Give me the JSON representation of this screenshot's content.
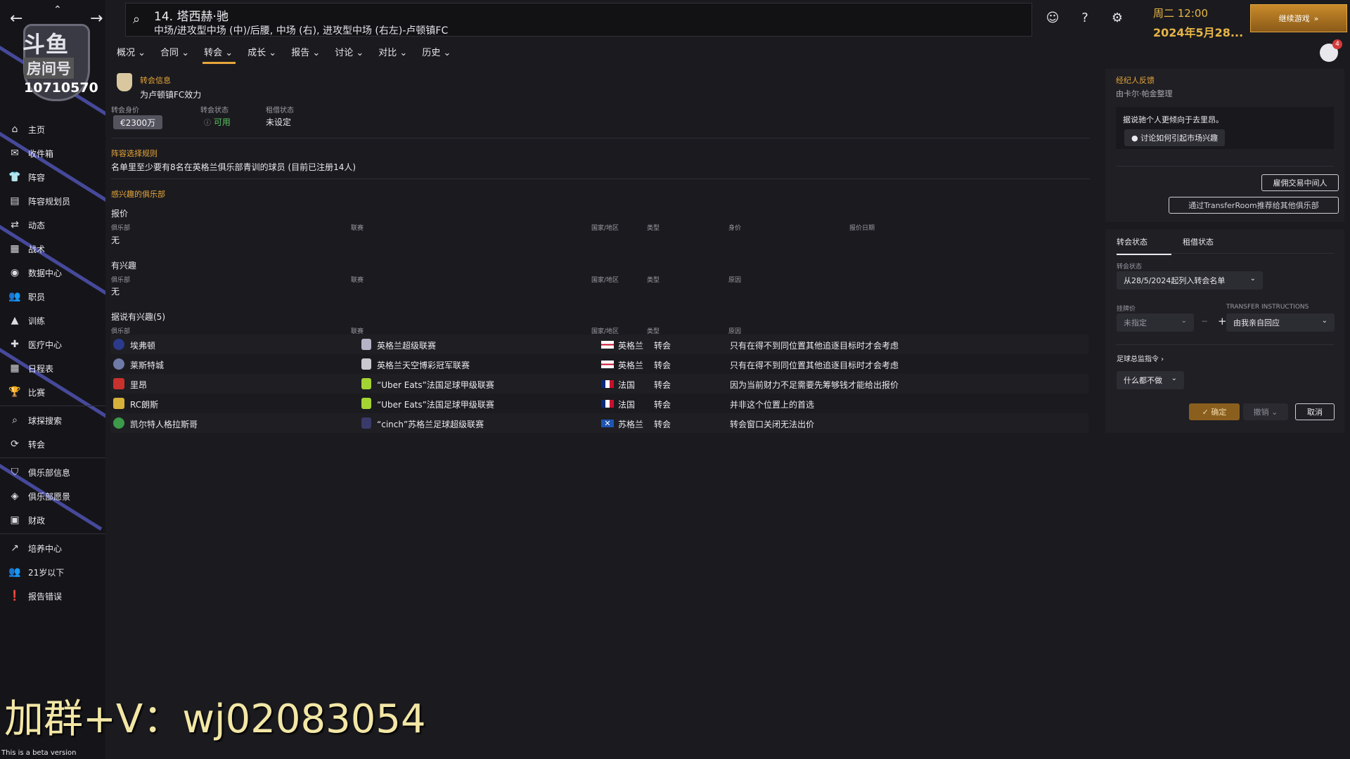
{
  "sidebar": {
    "logo_brand": "斗鱼",
    "logo_sub": "房间号",
    "logo_num": "10710570",
    "items": [
      {
        "label": "主页",
        "icon": "home-icon"
      },
      {
        "label": "收件箱",
        "icon": "inbox-icon"
      },
      {
        "label": "阵容",
        "icon": "shirt-icon"
      },
      {
        "label": "阵容规划员",
        "icon": "clipboard-icon"
      },
      {
        "label": "动态",
        "icon": "dynamics-icon"
      },
      {
        "label": "战术",
        "icon": "tactics-icon"
      },
      {
        "label": "数据中心",
        "icon": "data-hub-icon"
      },
      {
        "label": "职员",
        "icon": "staff-icon"
      },
      {
        "label": "训练",
        "icon": "training-icon"
      },
      {
        "label": "医疗中心",
        "icon": "medical-icon"
      },
      {
        "label": "日程表",
        "icon": "calendar-icon"
      },
      {
        "label": "比赛",
        "icon": "trophy-icon"
      },
      {
        "label": "球探搜索",
        "icon": "scouting-icon"
      },
      {
        "label": "转会",
        "icon": "transfer-icon"
      },
      {
        "label": "俱乐部信息",
        "icon": "shield-icon"
      },
      {
        "label": "俱乐部愿景",
        "icon": "vision-icon"
      },
      {
        "label": "财政",
        "icon": "finance-icon"
      },
      {
        "label": "培养中心",
        "icon": "development-icon"
      },
      {
        "label": "21岁以下",
        "icon": "u21-icon"
      },
      {
        "label": "报告错误",
        "icon": "error-report-icon"
      }
    ]
  },
  "topbar": {
    "player_title": "14. 塔西赫·驰",
    "player_subtitle": "中场/进攻型中场 (中)/后腰, 中场 (右), 进攻型中场 (右左)-卢顿镇FC",
    "date_line1": "周二 12:00",
    "date_line2": "2024年5月28...",
    "continue_label": "继续游戏",
    "notifications": "4"
  },
  "tabs": [
    {
      "label": "概况"
    },
    {
      "label": "合同"
    },
    {
      "label": "转会"
    },
    {
      "label": "成长"
    },
    {
      "label": "报告"
    },
    {
      "label": "讨论"
    },
    {
      "label": "对比"
    },
    {
      "label": "历史"
    }
  ],
  "transfer_info": {
    "title": "转会信息",
    "plays_for": "为卢顿镇FC效力",
    "value_label": "转会身价",
    "value": "€2300万",
    "status_label": "转会状态",
    "status": "可用",
    "loan_label": "租借状态",
    "loan": "未设定"
  },
  "squad_rule": {
    "title": "阵容选择规则",
    "text": "名单里至少要有8名在英格兰俱乐部青训的球员 (目前已注册14人)"
  },
  "interested": {
    "title": "感兴趣的俱乐部",
    "offers": {
      "heading": "报价",
      "columns": [
        "俱乐部",
        "联赛",
        "国家/地区",
        "类型",
        "身价",
        "报价日期"
      ],
      "empty": "无"
    },
    "interest": {
      "heading": "有兴趣",
      "columns": [
        "俱乐部",
        "联赛",
        "国家/地区",
        "类型",
        "原因"
      ],
      "empty": "无"
    },
    "rumoured": {
      "heading": "据说有兴趣(5)",
      "columns": [
        "俱乐部",
        "联赛",
        "国家/地区",
        "类型",
        "原因"
      ],
      "rows": [
        {
          "club": "埃弗顿",
          "league": "英格兰超级联赛",
          "nation": "英格兰",
          "type": "转会",
          "reason": "只有在得不到同位置其他追逐目标时才会考虑"
        },
        {
          "club": "莱斯特城",
          "league": "英格兰天空博彩冠军联赛",
          "nation": "英格兰",
          "type": "转会",
          "reason": "只有在得不到同位置其他追逐目标时才会考虑"
        },
        {
          "club": "里昂",
          "league": "“Uber Eats”法国足球甲级联赛",
          "nation": "法国",
          "type": "转会",
          "reason": "因为当前财力不足需要先筹够钱才能给出报价"
        },
        {
          "club": "RC朗斯",
          "league": "“Uber Eats”法国足球甲级联赛",
          "nation": "法国",
          "type": "转会",
          "reason": "并非这个位置上的首选"
        },
        {
          "club": "凯尔特人格拉斯哥",
          "league": "“cinch”苏格兰足球超级联赛",
          "nation": "苏格兰",
          "type": "转会",
          "reason": "转会窗口关闭无法出价"
        }
      ]
    }
  },
  "agent": {
    "title": "经纪人反馈",
    "subtitle": "由卡尔·帕金整理",
    "message": "据说驰个人更倾向于去里昂。",
    "discuss_button": "讨论如何引起市场兴趣",
    "hire_button": "雇佣交易中间人",
    "transferroom_button": "通过TransferRoom推荐给其他俱乐部"
  },
  "status_panel": {
    "tab_status": "转会状态",
    "tab_loan": "租借状态",
    "status_label": "转会状态",
    "status_value": "从28/5/2024起列入转会名单",
    "asking_label": "挂牌价",
    "asking_value": "未指定",
    "instructions_label": "TRANSFER INSTRUCTIONS",
    "instructions_value": "由我亲自回应",
    "director_label": "足球总监指令",
    "director_value": "什么都不做",
    "confirm": "确定",
    "undo": "撤销",
    "cancel": "取消"
  },
  "watermark": "加群+V：wj02083054",
  "beta_note": "This is a beta version",
  "colors": {
    "accent": "#e7a63a",
    "available": "#57c45f",
    "sidebar_stripe": "#4b4fa8"
  }
}
